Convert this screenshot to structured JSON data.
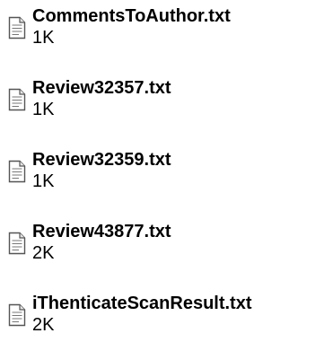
{
  "files": [
    {
      "name": "CommentsToAuthor.txt",
      "size": "1K",
      "icon": "text-document-icon"
    },
    {
      "name": "Review32357.txt",
      "size": "1K",
      "icon": "text-document-icon"
    },
    {
      "name": "Review32359.txt",
      "size": "1K",
      "icon": "text-document-icon"
    },
    {
      "name": "Review43877.txt",
      "size": "2K",
      "icon": "text-document-icon"
    },
    {
      "name": "iThenticateScanResult.txt",
      "size": "2K",
      "icon": "text-document-icon"
    }
  ]
}
